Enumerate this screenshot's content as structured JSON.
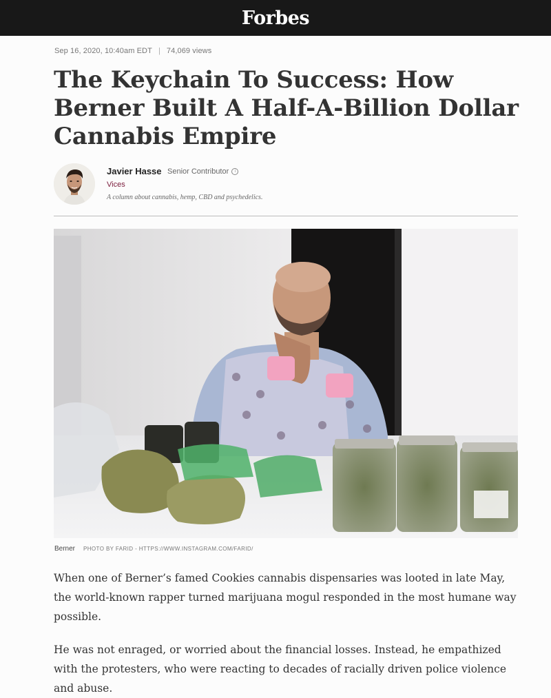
{
  "header": {
    "logo": "Forbes"
  },
  "article": {
    "date": "Sep 16, 2020, 10:40am EDT",
    "separator": "|",
    "views": "74,069 views",
    "title": "The Keychain To Success: How Berner Built A Half-A-Billion Dollar Cannabis Empire"
  },
  "author": {
    "name": "Javier Hasse",
    "role": "Senior Contributor",
    "info_icon": "info-icon",
    "channel": "Vices",
    "tagline": "A column about cannabis, hemp, CBD and psychedelics."
  },
  "image": {
    "caption_name": "Berner",
    "credit": "PHOTO BY FARID - HTTPS://WWW.INSTAGRAM.COM/FARID/"
  },
  "body": {
    "paragraphs": [
      "When one of Berner’s famed Cookies cannabis dispensaries was looted in late May, the world-known rapper turned marijuana mogul responded in the most humane way possible.",
      "He was not enraged, or worried about the financial losses. Instead, he empathized with the protesters, who were reacting to decades of racially driven police violence and abuse."
    ]
  },
  "colors": {
    "topbar": "#181818",
    "channel_link": "#7a1a3a",
    "text": "#333333"
  }
}
